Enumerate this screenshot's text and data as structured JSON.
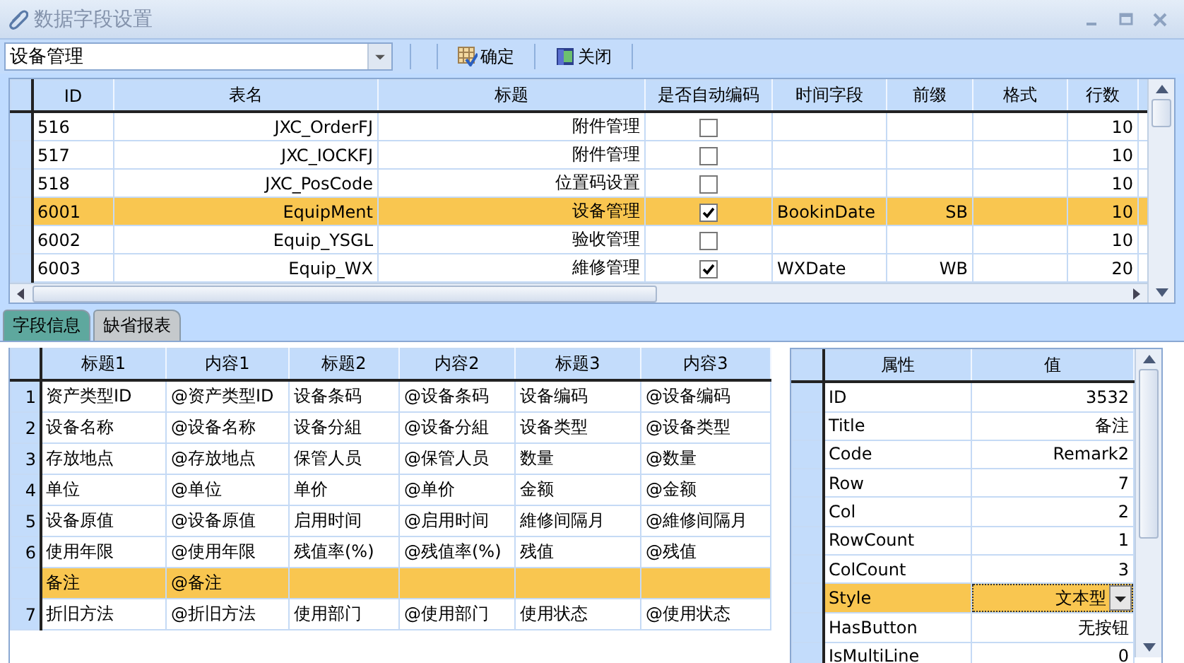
{
  "window": {
    "title": "数据字段设置"
  },
  "toolbar": {
    "table_select": {
      "value": "设备管理"
    },
    "buttons": [
      {
        "label": "确定",
        "kind": "confirm"
      },
      {
        "label": "关闭",
        "kind": "close"
      }
    ]
  },
  "table": {
    "columns": [
      "ID",
      "表名",
      "标题",
      "是否自动编码",
      "时间字段",
      "前缀",
      "格式",
      "行数"
    ],
    "rows": [
      {
        "id": "516",
        "table_name": "JXC_OrderFJ",
        "title": "附件管理",
        "auto_code": false,
        "row_count": "10",
        "selected": false
      },
      {
        "id": "517",
        "table_name": "JXC_IOCKFJ",
        "title": "附件管理",
        "auto_code": false,
        "row_count": "10",
        "selected": false
      },
      {
        "id": "518",
        "table_name": "JXC_PosCode",
        "title": "位置码设置",
        "auto_code": false,
        "row_count": "10",
        "selected": false
      },
      {
        "id": "6001",
        "table_name": "EquipMent",
        "title": "设备管理",
        "auto_code": true,
        "time_field": "BookinDate",
        "prefix": "SB",
        "row_count": "10",
        "selected": true
      },
      {
        "id": "6002",
        "table_name": "Equip_YSGL",
        "title": "验收管理",
        "auto_code": false,
        "row_count": "10",
        "selected": false
      },
      {
        "id": "6003",
        "table_name": "Equip_WX",
        "title": "維修管理",
        "auto_code": true,
        "time_field": "WXDate",
        "prefix": "WB",
        "row_count": "20",
        "selected": false
      }
    ]
  },
  "tabs": [
    {
      "label": "字段信息",
      "selected": true
    },
    {
      "label": "缺省报表",
      "selected": false
    }
  ],
  "fields_grid": {
    "columns": [
      "标题1",
      "内容1",
      "标题2",
      "内容2",
      "标题3",
      "内容3"
    ],
    "rows": [
      {
        "number": "1",
        "cells": [
          "资产类型ID",
          "@资产类型ID",
          "设备条码",
          "@设备条码",
          "设备编码",
          "@设备编码"
        ],
        "selected": false
      },
      {
        "number": "2",
        "cells": [
          "设备名称",
          "@设备名称",
          "设备分組",
          "@设备分組",
          "设备类型",
          "@设备类型"
        ],
        "selected": false
      },
      {
        "number": "3",
        "cells": [
          "存放地点",
          "@存放地点",
          "保管人员",
          "@保管人员",
          "数量",
          "@数量"
        ],
        "selected": false
      },
      {
        "number": "4",
        "cells": [
          "单位",
          "@单位",
          "单价",
          "@单价",
          "金额",
          "@金额"
        ],
        "selected": false
      },
      {
        "number": "5",
        "cells": [
          "设备原值",
          "@设备原值",
          "启用时间",
          "@启用时间",
          "維修间隔月",
          "@維修间隔月"
        ],
        "selected": false
      },
      {
        "number": "6",
        "cells": [
          "使用年限",
          "@使用年限",
          "残值率(%)",
          "@残值率(%)",
          "残值",
          "@残值"
        ],
        "selected": false
      },
      {
        "cells": [
          "备注",
          "@备注"
        ],
        "selected": true
      },
      {
        "number": "7",
        "cells": [
          "折旧方法",
          "@折旧方法",
          "使用部门",
          "@使用部门",
          "使用状态",
          "@使用状态"
        ],
        "selected": false
      }
    ]
  },
  "properties": {
    "columns": [
      "属性",
      "值"
    ],
    "rows": [
      {
        "name": "ID",
        "value": "3532",
        "kind": "text",
        "selected": false
      },
      {
        "name": "Title",
        "value": "备注",
        "kind": "text",
        "selected": false
      },
      {
        "name": "Code",
        "value": "Remark2",
        "kind": "text",
        "selected": false
      },
      {
        "name": "Row",
        "value": "7",
        "kind": "text",
        "selected": false
      },
      {
        "name": "Col",
        "value": "2",
        "kind": "text",
        "selected": false
      },
      {
        "name": "RowCount",
        "value": "1",
        "kind": "text",
        "selected": false
      },
      {
        "name": "ColCount",
        "value": "3",
        "kind": "text",
        "selected": false
      },
      {
        "name": "Style",
        "value": "文本型",
        "kind": "dropdown",
        "selected": true
      },
      {
        "name": "HasButton",
        "value": "无按钮",
        "kind": "text",
        "selected": false
      },
      {
        "name": "IsMultiLine",
        "value": "0",
        "kind": "text",
        "selected": false
      }
    ]
  }
}
